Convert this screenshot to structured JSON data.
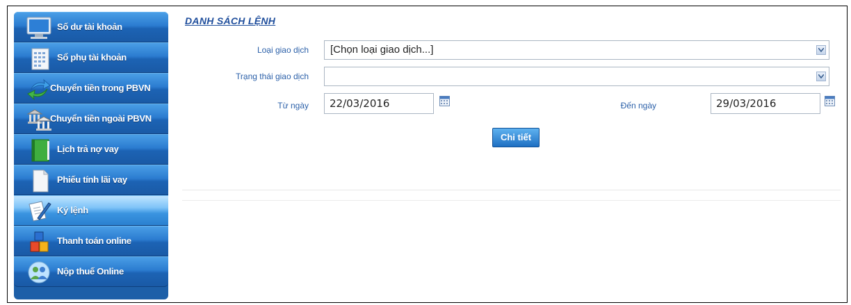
{
  "sidebar": {
    "items": [
      {
        "label": "Số dư tài khoản",
        "icon": "monitor-icon"
      },
      {
        "label": "Sổ phụ tài khoản",
        "icon": "calendar-grid-icon"
      },
      {
        "label": "Chuyển tiền trong PBVN",
        "icon": "transfer-arrows-icon"
      },
      {
        "label": "Chuyển tiền ngoài PBVN",
        "icon": "bank-building-icon"
      },
      {
        "label": "Lịch trả nợ vay",
        "icon": "green-book-icon"
      },
      {
        "label": "Phiếu tính lãi vay",
        "icon": "document-icon"
      },
      {
        "label": "Ký lệnh",
        "icon": "sign-pen-icon"
      },
      {
        "label": "Thanh toán online",
        "icon": "colored-blocks-icon"
      },
      {
        "label": "Nộp thuế Online",
        "icon": "users-globe-icon"
      }
    ],
    "active_index": 6
  },
  "main": {
    "title": "DANH SÁCH LỆNH",
    "transaction_type": {
      "label": "Loại giao dịch",
      "value": "[Chọn loại giao dịch...]"
    },
    "transaction_status": {
      "label": "Trạng thái giao dịch",
      "value": ""
    },
    "from_date": {
      "label": "Từ ngày",
      "value": "22/03/2016"
    },
    "to_date": {
      "label": "Đến ngày",
      "value": "29/03/2016"
    },
    "detail_button": "Chi tiết"
  },
  "colors": {
    "accent": "#1f4e9c",
    "label": "#2a5fa8",
    "sidebar": "#2b7cd0"
  }
}
